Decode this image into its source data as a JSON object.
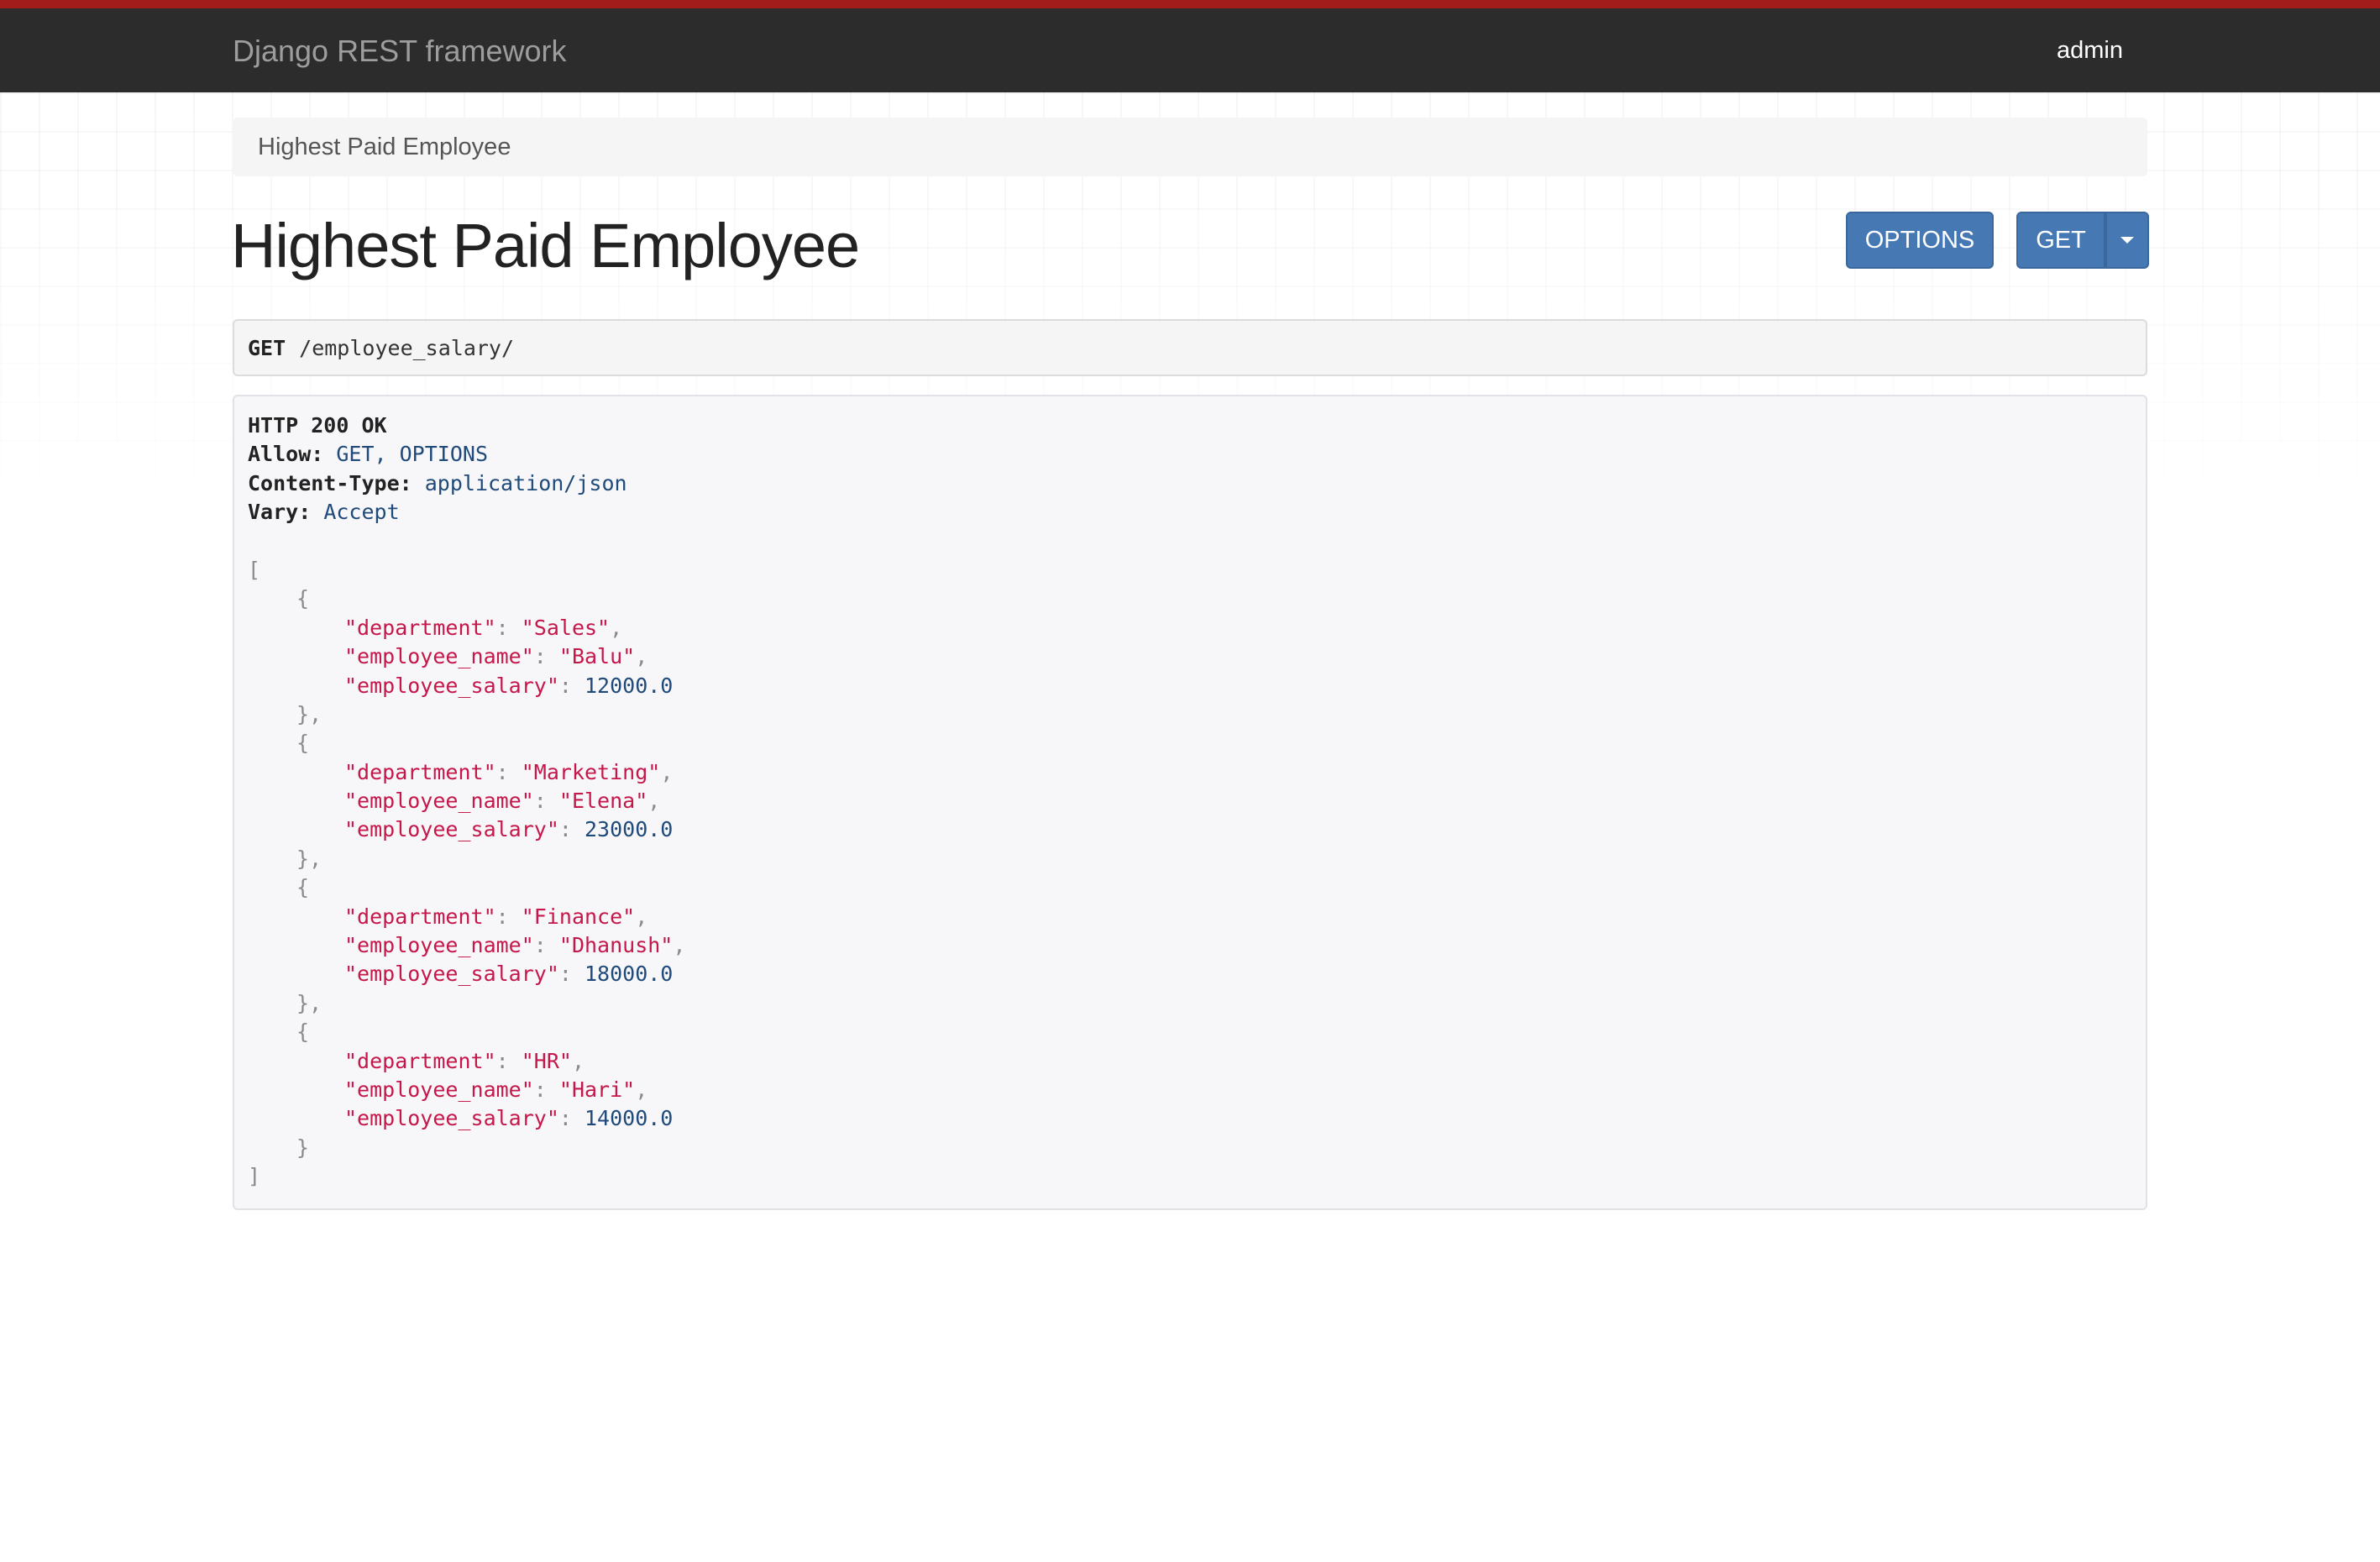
{
  "navbar": {
    "brand": "Django REST framework",
    "user": "admin"
  },
  "breadcrumb": {
    "current": "Highest Paid Employee"
  },
  "page": {
    "title": "Highest Paid Employee"
  },
  "buttons": {
    "options_label": "OPTIONS",
    "get_label": "GET"
  },
  "request": {
    "method": "GET",
    "path": "/employee_salary/"
  },
  "response": {
    "status": "HTTP 200 OK",
    "headers": [
      {
        "key": "Allow:",
        "value": "GET, OPTIONS"
      },
      {
        "key": "Content-Type:",
        "value": "application/json"
      },
      {
        "key": "Vary:",
        "value": "Accept"
      }
    ],
    "records": [
      {
        "department": "\"Sales\"",
        "employee_name": "\"Balu\"",
        "employee_salary": "12000.0"
      },
      {
        "department": "\"Marketing\"",
        "employee_name": "\"Elena\"",
        "employee_salary": "23000.0"
      },
      {
        "department": "\"Finance\"",
        "employee_name": "\"Dhanush\"",
        "employee_salary": "18000.0"
      },
      {
        "department": "\"HR\"",
        "employee_name": "\"Hari\"",
        "employee_salary": "14000.0"
      }
    ],
    "field_keys": {
      "department": "\"department\"",
      "employee_name": "\"employee_name\"",
      "employee_salary": "\"employee_salary\""
    }
  },
  "colors": {
    "navbar_bg": "#2c2c2c",
    "navbar_accent": "#a31c1c",
    "button_bg": "#4679b4",
    "json_key": "#c5174a",
    "json_number": "#1f4a7a"
  }
}
